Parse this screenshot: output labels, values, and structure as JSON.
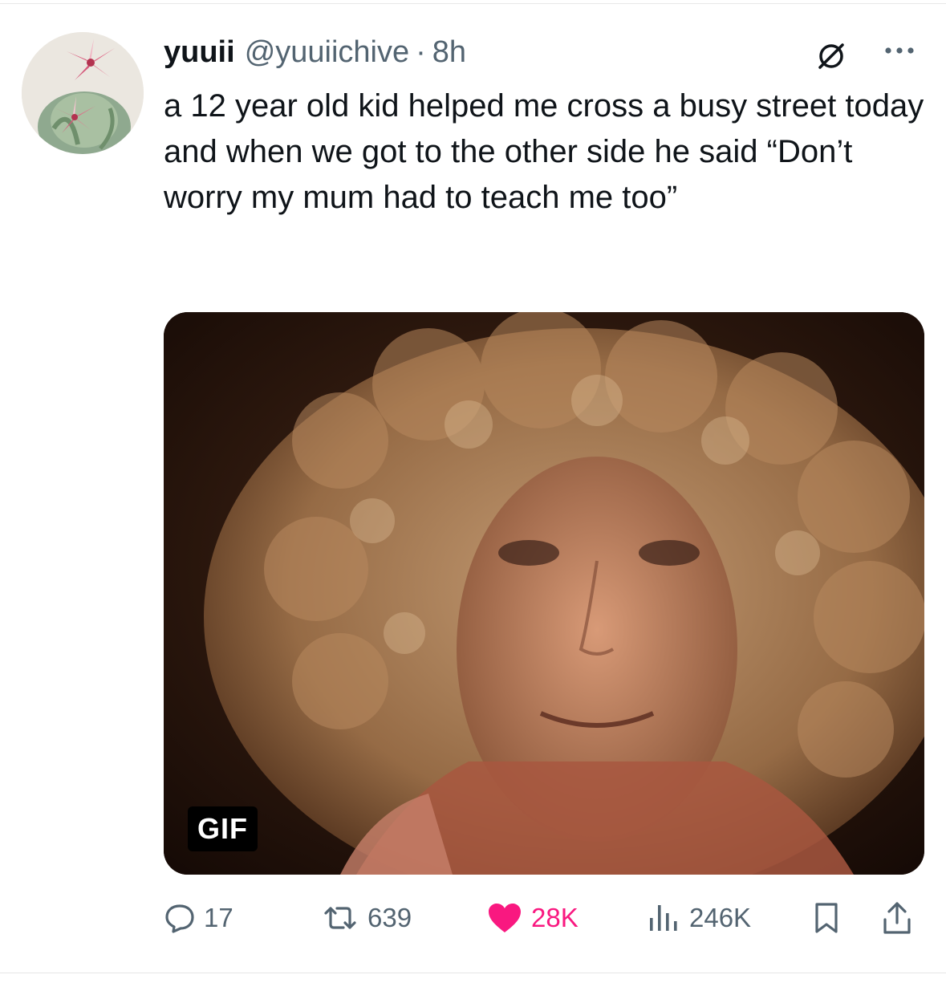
{
  "tweet": {
    "author": {
      "display_name": "yuuii",
      "handle": "@yuuiichive",
      "separator": "·",
      "time": "8h",
      "avatar": "flower-vase-avatar"
    },
    "text": "a 12 year old kid helped me cross a busy street today and when we got to the other side he said “Don’t worry my mum had to teach me too”",
    "media": {
      "type": "gif",
      "badge": "GIF",
      "description_icon": "curly-haired-woman-gif"
    },
    "metrics": {
      "replies": "17",
      "reposts": "639",
      "likes": "28K",
      "views": "246K"
    },
    "colors": {
      "text_primary": "#0f1419",
      "text_secondary": "#536471",
      "like_accent": "#f91880"
    },
    "icons": {
      "grok": "grok-icon",
      "more": "more-icon",
      "reply": "reply-icon",
      "repost": "repost-icon",
      "like": "heart-icon",
      "views": "views-chart-icon",
      "bookmark": "bookmark-icon",
      "share": "share-icon"
    }
  }
}
